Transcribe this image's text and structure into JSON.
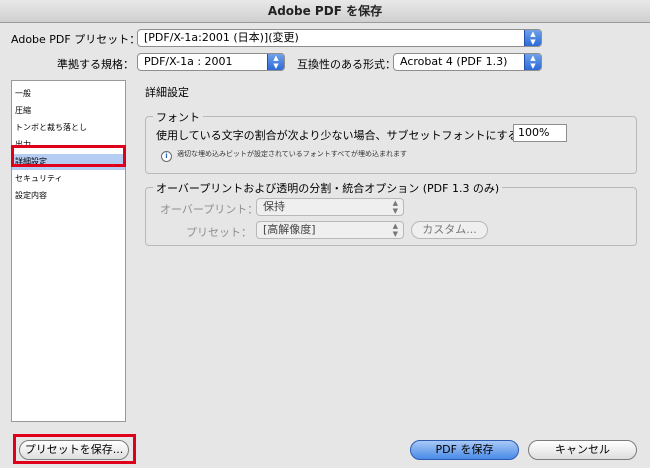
{
  "window": {
    "title": "Adobe PDF を保存"
  },
  "preset": {
    "label": "Adobe PDF プリセット：",
    "value": "[PDF/X-1a:2001 (日本)](変更)"
  },
  "standard": {
    "label": "準拠する規格：",
    "value": "PDF/X-1a : 2001"
  },
  "compat": {
    "label": "互換性のある形式：",
    "value": "Acrobat 4 (PDF 1.3)"
  },
  "sidebar": {
    "items": [
      {
        "label": "一般"
      },
      {
        "label": "圧縮"
      },
      {
        "label": "トンボと裁ち落とし"
      },
      {
        "label": "出力"
      },
      {
        "label": "詳細設定"
      },
      {
        "label": "セキュリティ"
      },
      {
        "label": "設定内容"
      }
    ],
    "selected_index": 4
  },
  "panel": {
    "title": "詳細設定",
    "fonts": {
      "title": "フォント",
      "subset_label": "使用している文字の割合が次より少ない場合、サブセットフォントにする：",
      "subset_value": "100%",
      "info_text": "適切な埋め込みビットが設定されているフォントすべてが埋め込まれます"
    },
    "overprint": {
      "title": "オーバープリントおよび透明の分割・統合オプション (PDF 1.3 のみ)",
      "overprint_label": "オーバープリント：",
      "overprint_value": "保持",
      "preset_label": "プリセット：",
      "preset_value": "[高解像度]",
      "custom_button": "カスタム..."
    }
  },
  "footer": {
    "save_preset_button": "プリセットを保存...",
    "save_pdf_button": "PDF を保存",
    "cancel_button": "キャンセル"
  },
  "colors": {
    "highlight": "#e0001b",
    "selection": "#b5cdf3",
    "accent": "#4a8ae8"
  }
}
